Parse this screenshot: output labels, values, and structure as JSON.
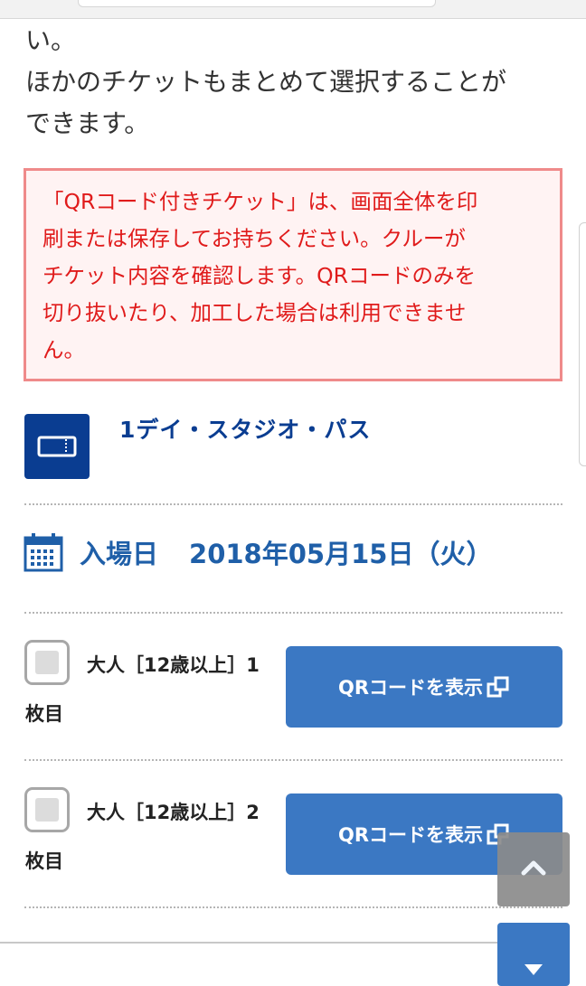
{
  "intro": {
    "line1": "い。",
    "line2": "ほかのチケットもまとめて選択することが",
    "line3": "できます。"
  },
  "notice": {
    "line1": "「QRコード付きチケット」は、画面全体を印",
    "line2": "刷または保存してお持ちください。クルーが",
    "line3": "チケット内容を確認します。QRコードのみを",
    "line4": "切り抜いたり、加工した場合は利用できませ",
    "line5": "ん。"
  },
  "ticket": {
    "name": "1デイ・スタジオ・パス",
    "icon": "ticket-icon"
  },
  "entry": {
    "label": "入場日",
    "date": "2018年05月15日（火）",
    "icon": "calendar-icon"
  },
  "tickets": [
    {
      "line1": "大人［12歳以上］1",
      "line2": "枚目",
      "button_label": "QRコードを表示",
      "checked": false
    },
    {
      "line1": "大人［12歳以上］2",
      "line2": "枚目",
      "button_label": "QRコードを表示",
      "checked": false
    }
  ],
  "colors": {
    "brand_blue": "#0a3d91",
    "link_blue": "#1f5fa8",
    "button_blue": "#3b78c3",
    "notice_red": "#e01b1b",
    "notice_border": "#ef8a8a",
    "notice_bg": "#fff3f3"
  },
  "controls": {
    "scroll_up_icon": "chevron-up-icon",
    "scroll_down_icon": "chevron-down-icon",
    "external_icon": "external-window-icon"
  }
}
